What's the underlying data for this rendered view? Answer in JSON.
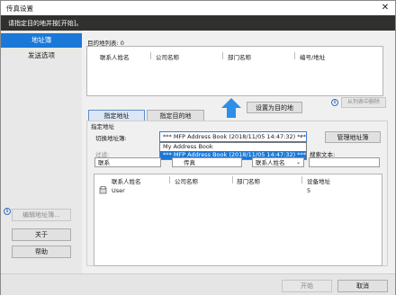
{
  "window": {
    "title": "传真设置",
    "close": "✕"
  },
  "header": {
    "title": "请指定目的地并按[开始]。"
  },
  "sidebar": {
    "items": [
      {
        "label": "地址簿"
      },
      {
        "label": "发送选项"
      }
    ],
    "edit_address_book": "编辑地址簿...",
    "about": "关于",
    "help": "帮助"
  },
  "destinations": {
    "label": "目的地列表: 0",
    "columns": [
      "联系人姓名",
      "公司名称",
      "部门名称",
      "编号/地址"
    ],
    "remove_button": "从列表中删除",
    "set_dest_button": "设置为目的地"
  },
  "tabs": {
    "specify_address": "指定地址",
    "specify_dest": "指定目的地"
  },
  "specify": {
    "group_label": "指定地址",
    "switch_label": "切换地址簿:",
    "selected_book": "*** MFP Address Book (2018/11/05 14:47:32) ***",
    "manage_button": "管理地址簿",
    "options": [
      "My Address Book",
      "*** MFP Address Book (2018/11/05 14:47:32) ***"
    ],
    "filter_label": "过滤:",
    "filter_value": "联系",
    "type_value": "传真",
    "field_value": "联系人姓名",
    "search_label": "搜索文本:",
    "search_value": "",
    "list_columns": [
      "联系人姓名",
      "公司名称",
      "部门名称",
      "设备地址"
    ],
    "rows": [
      {
        "name": "User",
        "company": "",
        "dept": "",
        "addr": "5"
      }
    ]
  },
  "footer": {
    "start": "开始",
    "cancel": "取消"
  },
  "colors": {
    "accent": "#1a78d8",
    "header": "#30302f",
    "selected": "#1a78d8",
    "arrow": "#2e8fe6"
  }
}
